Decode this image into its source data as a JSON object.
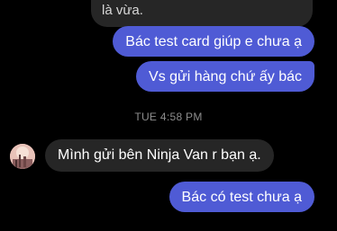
{
  "messages": {
    "incoming_cut_line1": "",
    "incoming_cut_line2": "là vừa.",
    "outgoing_1": "Bác test card giúp e chưa ạ",
    "outgoing_2": "Vs gửi hàng chứ ấy bác",
    "timestamp": "TUE 4:58 PM",
    "incoming_1": "Mình gửi bên Ninja Van r bạn ạ.",
    "outgoing_3": "Bác có test chưa ạ"
  },
  "colors": {
    "background": "#000000",
    "outgoing_bubble": "#4f5bd5",
    "incoming_bubble": "#262626",
    "timestamp_text": "#8e8e8e"
  },
  "icons": {
    "avatar": "user-avatar-photo"
  }
}
